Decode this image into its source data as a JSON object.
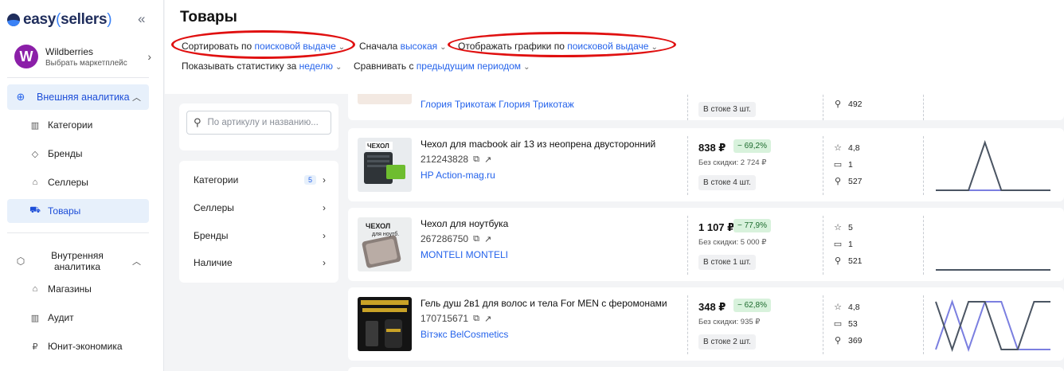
{
  "app": {
    "logo_word": "easy",
    "logo_word2": "sellers",
    "collapse_icon": "«"
  },
  "marketplace": {
    "avatar_letter": "W",
    "name": "Wildberries",
    "subtitle": "Выбрать маркетплейс",
    "avatar_color": "#8b1fa8"
  },
  "sidebar": {
    "external_group": "Внешняя аналитика",
    "external_items": [
      {
        "label": "Категории",
        "icon": "categories-icon"
      },
      {
        "label": "Бренды",
        "icon": "tag-icon"
      },
      {
        "label": "Селлеры",
        "icon": "store-icon"
      },
      {
        "label": "Товары",
        "icon": "cart-icon",
        "active": true
      }
    ],
    "internal_group": "Внутренняя аналитика",
    "internal_items": [
      {
        "label": "Магазины",
        "icon": "store-icon"
      },
      {
        "label": "Аудит",
        "icon": "audit-icon"
      },
      {
        "label": "Юнит-экономика",
        "icon": "ruble-icon"
      }
    ]
  },
  "header": {
    "title": "Товары",
    "options": {
      "sort_prefix": "Сортировать по",
      "sort_value": "поисковой выдаче",
      "order_prefix": "Сначала",
      "order_value": "высокая",
      "graphs_prefix": "Отображать графики по",
      "graphs_value": "поисковой выдаче",
      "stats_prefix": "Показывать статистику за",
      "stats_value": "неделю",
      "compare_prefix": "Сравнивать с",
      "compare_value": "предыдущим периодом"
    },
    "highlight_color": "#e01010"
  },
  "filters": {
    "search_placeholder": "По артикулу и названию...",
    "facets": [
      {
        "label": "Категории",
        "badge": "5"
      },
      {
        "label": "Селлеры"
      },
      {
        "label": "Бренды"
      },
      {
        "label": "Наличие"
      }
    ]
  },
  "partial_row": {
    "brand": "Глория Трикотаж Глория Трикотаж",
    "stock": "В стоке 3 шт.",
    "search_count": "492"
  },
  "products": [
    {
      "name": "Чехол для macbook air 13 из неопрена двусторонний",
      "article": "212243828",
      "brand": "HP Action-mag.ru",
      "price": "838 ₽",
      "discount": "− 69,2%",
      "no_discount": "Без скидки: 2 724 ₽",
      "stock": "В стоке 4 шт.",
      "rating": "4,8",
      "reviews": "1",
      "search": "527",
      "spark": {
        "primary": [
          0,
          0,
          0,
          1,
          0,
          0,
          0,
          0
        ],
        "secondary": [
          0,
          0,
          0,
          0,
          0,
          0,
          0,
          0
        ]
      }
    },
    {
      "name": "Чехол для ноутбука",
      "article": "267286750",
      "brand": "MONTELI  MONTELI",
      "price": "1 107 ₽",
      "discount": "− 77,9%",
      "no_discount": "Без скидки: 5 000 ₽",
      "stock": "В стоке 1 шт.",
      "rating": "5",
      "reviews": "1",
      "search": "521",
      "spark": {
        "primary": [
          0,
          0,
          0,
          0,
          0,
          0,
          0,
          0
        ],
        "secondary": [
          0,
          0,
          0,
          0,
          0,
          0,
          0,
          0
        ]
      }
    },
    {
      "name": "Гель душ 2в1 для волос и тела For MEN с феромонами",
      "article": "170715671",
      "brand": "Вітэкс  BelCosmetics",
      "price": "348 ₽",
      "discount": "− 62,8%",
      "no_discount": "Без скидки: 935 ₽",
      "stock": "В стоке 2 шт.",
      "rating": "4,8",
      "reviews": "53",
      "search": "369",
      "spark": {
        "primary": [
          1,
          0,
          1,
          1,
          0,
          0,
          1,
          1
        ],
        "secondary": [
          0,
          1,
          0,
          1,
          1,
          0,
          0,
          0
        ]
      }
    }
  ],
  "colors": {
    "accent": "#2563eb",
    "spark_primary": "#4b5563",
    "spark_secondary": "#7b7fe0",
    "discount_bg": "#d8f2dc"
  }
}
